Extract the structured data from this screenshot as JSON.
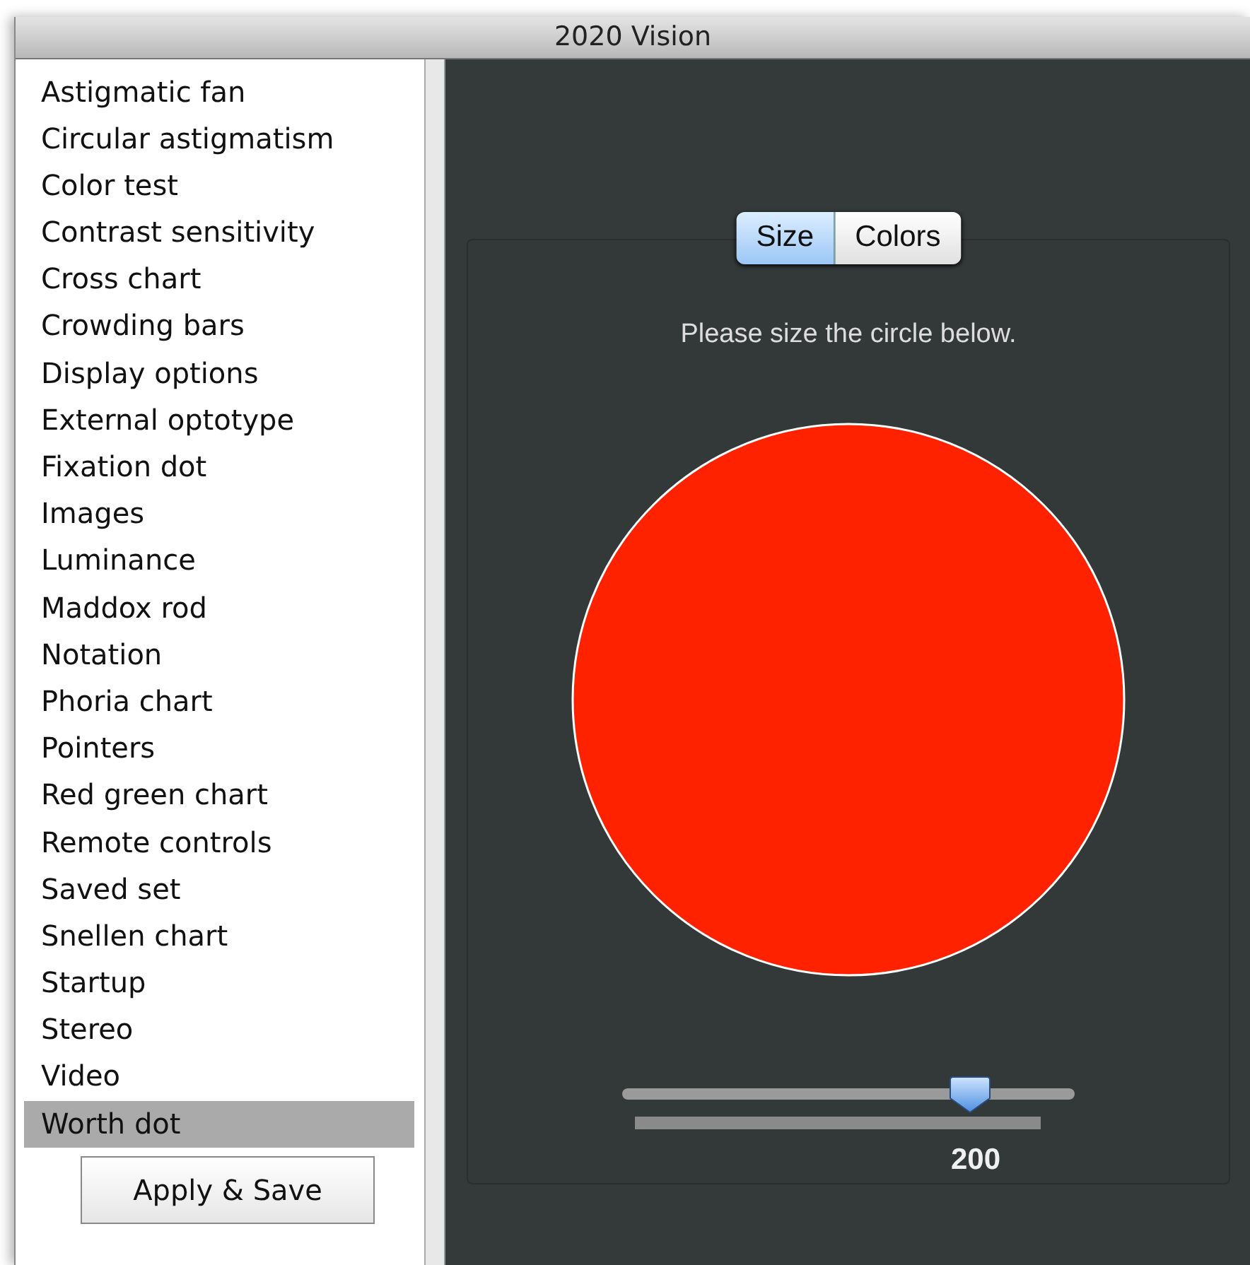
{
  "window": {
    "title": "2020 Vision"
  },
  "sidebar": {
    "items": [
      {
        "label": "Astigmatic fan",
        "selected": false
      },
      {
        "label": "Circular astigmatism",
        "selected": false
      },
      {
        "label": "Color test",
        "selected": false
      },
      {
        "label": "Contrast sensitivity",
        "selected": false
      },
      {
        "label": "Cross chart",
        "selected": false
      },
      {
        "label": "Crowding bars",
        "selected": false
      },
      {
        "label": "Display options",
        "selected": false
      },
      {
        "label": "External optotype",
        "selected": false
      },
      {
        "label": "Fixation dot",
        "selected": false
      },
      {
        "label": "Images",
        "selected": false
      },
      {
        "label": "Luminance",
        "selected": false
      },
      {
        "label": "Maddox rod",
        "selected": false
      },
      {
        "label": "Notation",
        "selected": false
      },
      {
        "label": "Phoria chart",
        "selected": false
      },
      {
        "label": "Pointers",
        "selected": false
      },
      {
        "label": "Red green chart",
        "selected": false
      },
      {
        "label": "Remote controls",
        "selected": false
      },
      {
        "label": "Saved set",
        "selected": false
      },
      {
        "label": "Snellen chart",
        "selected": false
      },
      {
        "label": "Startup",
        "selected": false
      },
      {
        "label": "Stereo",
        "selected": false
      },
      {
        "label": "Video",
        "selected": false
      },
      {
        "label": "Worth dot",
        "selected": true
      }
    ],
    "button": "Apply & Save"
  },
  "tabs": [
    {
      "label": "Size",
      "selected": true
    },
    {
      "label": "Colors",
      "selected": false
    }
  ],
  "instruction": "Please size the circle below.",
  "circle": {
    "color": "#ff2200"
  },
  "slider": {
    "level": 0.77,
    "reading": "200"
  }
}
